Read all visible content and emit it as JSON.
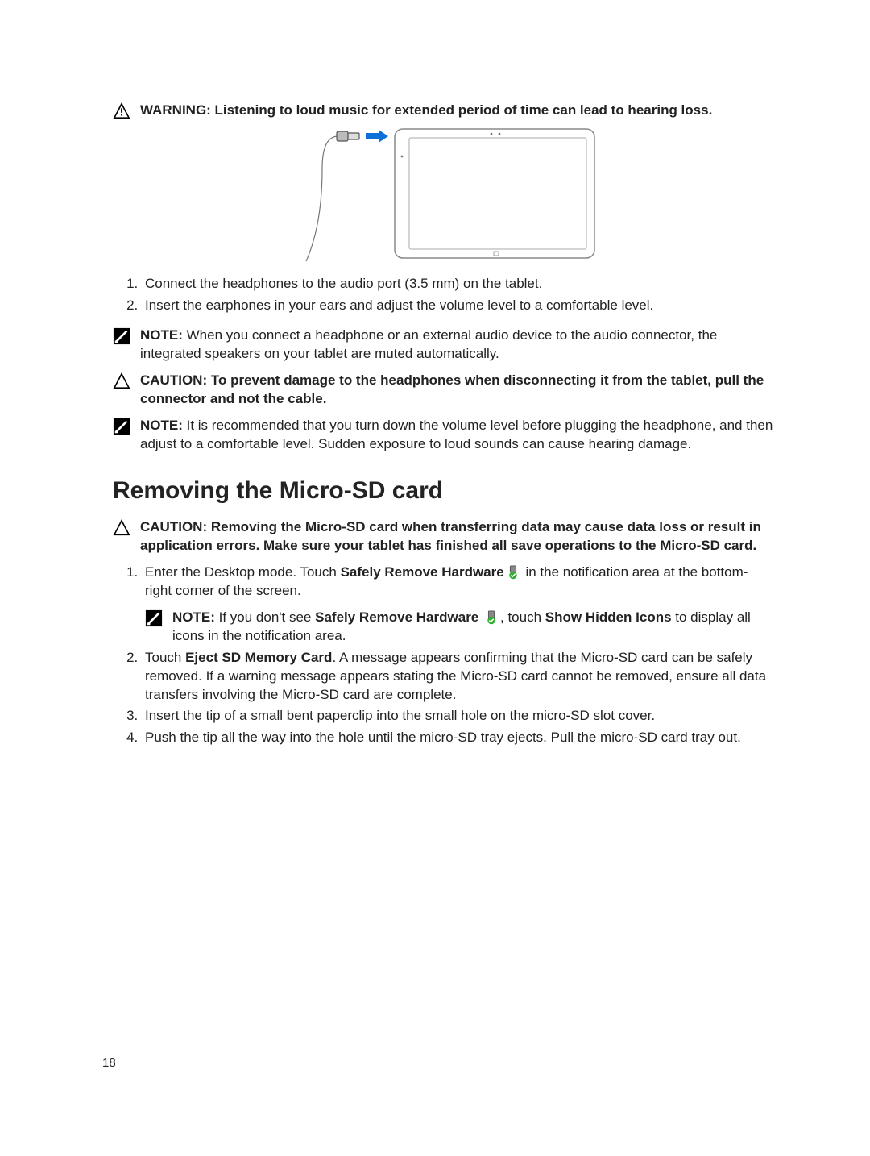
{
  "labels": {
    "warning": "WARNING:",
    "caution": "CAUTION:",
    "note": "NOTE:"
  },
  "warning1": " Listening to loud music for extended period of time can lead to hearing loss.",
  "headphone_steps": [
    "Connect the headphones to the audio port (3.5 mm) on the tablet.",
    "Insert the earphones in your ears and adjust the volume level to a comfortable level."
  ],
  "note1": " When you connect a headphone or an external audio device to the audio connector, the integrated speakers on your tablet are muted automatically.",
  "caution1": " To prevent damage to the headphones when disconnecting it from the tablet, pull the connector and not the cable.",
  "note2": " It is recommended that you turn down the volume level before plugging the headphone, and then adjust to a comfortable level. Sudden exposure to loud sounds can cause hearing damage.",
  "section_title": "Removing the Micro-SD card",
  "caution2": " Removing the Micro-SD card when transferring data may cause data loss or result in application errors. Make sure your tablet has finished all save operations to the Micro-SD card.",
  "sd_steps": {
    "s1_a": "Enter the Desktop mode. Touch ",
    "s1_b": "Safely Remove Hardware",
    "s1_c": " in the notification area at the bottom-right corner of the screen.",
    "s1_note_a": " If you don't see ",
    "s1_note_b": "Safely Remove Hardware",
    "s1_note_c": ", touch ",
    "s1_note_d": "Show Hidden Icons",
    "s1_note_e": " to display all icons in the notification area.",
    "s2_a": "Touch ",
    "s2_b": "Eject SD Memory Card",
    "s2_c": ". A message appears confirming that the Micro-SD card can be safely removed. If a warning message appears stating the Micro-SD card cannot be removed, ensure all data transfers involving the Micro-SD card are complete.",
    "s3": "Insert the tip of a small bent paperclip into the small hole on the micro-SD slot cover.",
    "s4": "Push the tip all the way into the hole until the micro-SD tray ejects. Pull the micro-SD card tray out."
  },
  "page_number": "18"
}
